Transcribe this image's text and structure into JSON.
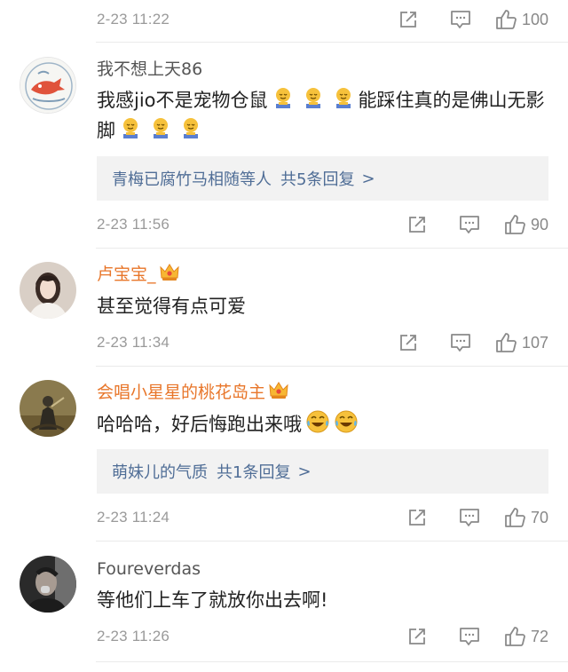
{
  "top_meta": {
    "time": "2-23 11:22",
    "likes": "100"
  },
  "comments": [
    {
      "username": "我不想上天86",
      "vip": false,
      "text_a": "我感jio不是宠物仓鼠",
      "text_b": "能踩住真的是佛山无影脚",
      "reply_box": {
        "name": "青梅已腐竹马相随",
        "suffix": "等人",
        "count": "共5条回复",
        "arrow": ">"
      },
      "time": "2-23 11:56",
      "likes": "90"
    },
    {
      "username": "卢宝宝_",
      "vip": true,
      "text": "甚至觉得有点可爱",
      "time": "2-23 11:34",
      "likes": "107"
    },
    {
      "username": "会唱小星星的桃花岛主",
      "vip": true,
      "text": "哈哈哈，好后悔跑出来哦",
      "reply_box": {
        "name": "萌妹儿的气质",
        "count": "共1条回复",
        "arrow": ">"
      },
      "time": "2-23 11:24",
      "likes": "70"
    },
    {
      "username": "Foureverdas",
      "vip": false,
      "text": "等他们上车了就放你出去啊!",
      "time": "2-23 11:26",
      "likes": "72"
    }
  ],
  "icons": {
    "share": "share-icon",
    "reply": "comment-icon",
    "like": "thumbs-up-icon",
    "vip": "crown-icon",
    "emoji_1": "kneeling-emoji",
    "emoji_2": "laugh-cry-emoji"
  },
  "colors": {
    "link": "#4f6d96",
    "vip_name": "#e8762a",
    "meta": "#9a9a9a",
    "reply_bg": "#f2f2f2"
  }
}
